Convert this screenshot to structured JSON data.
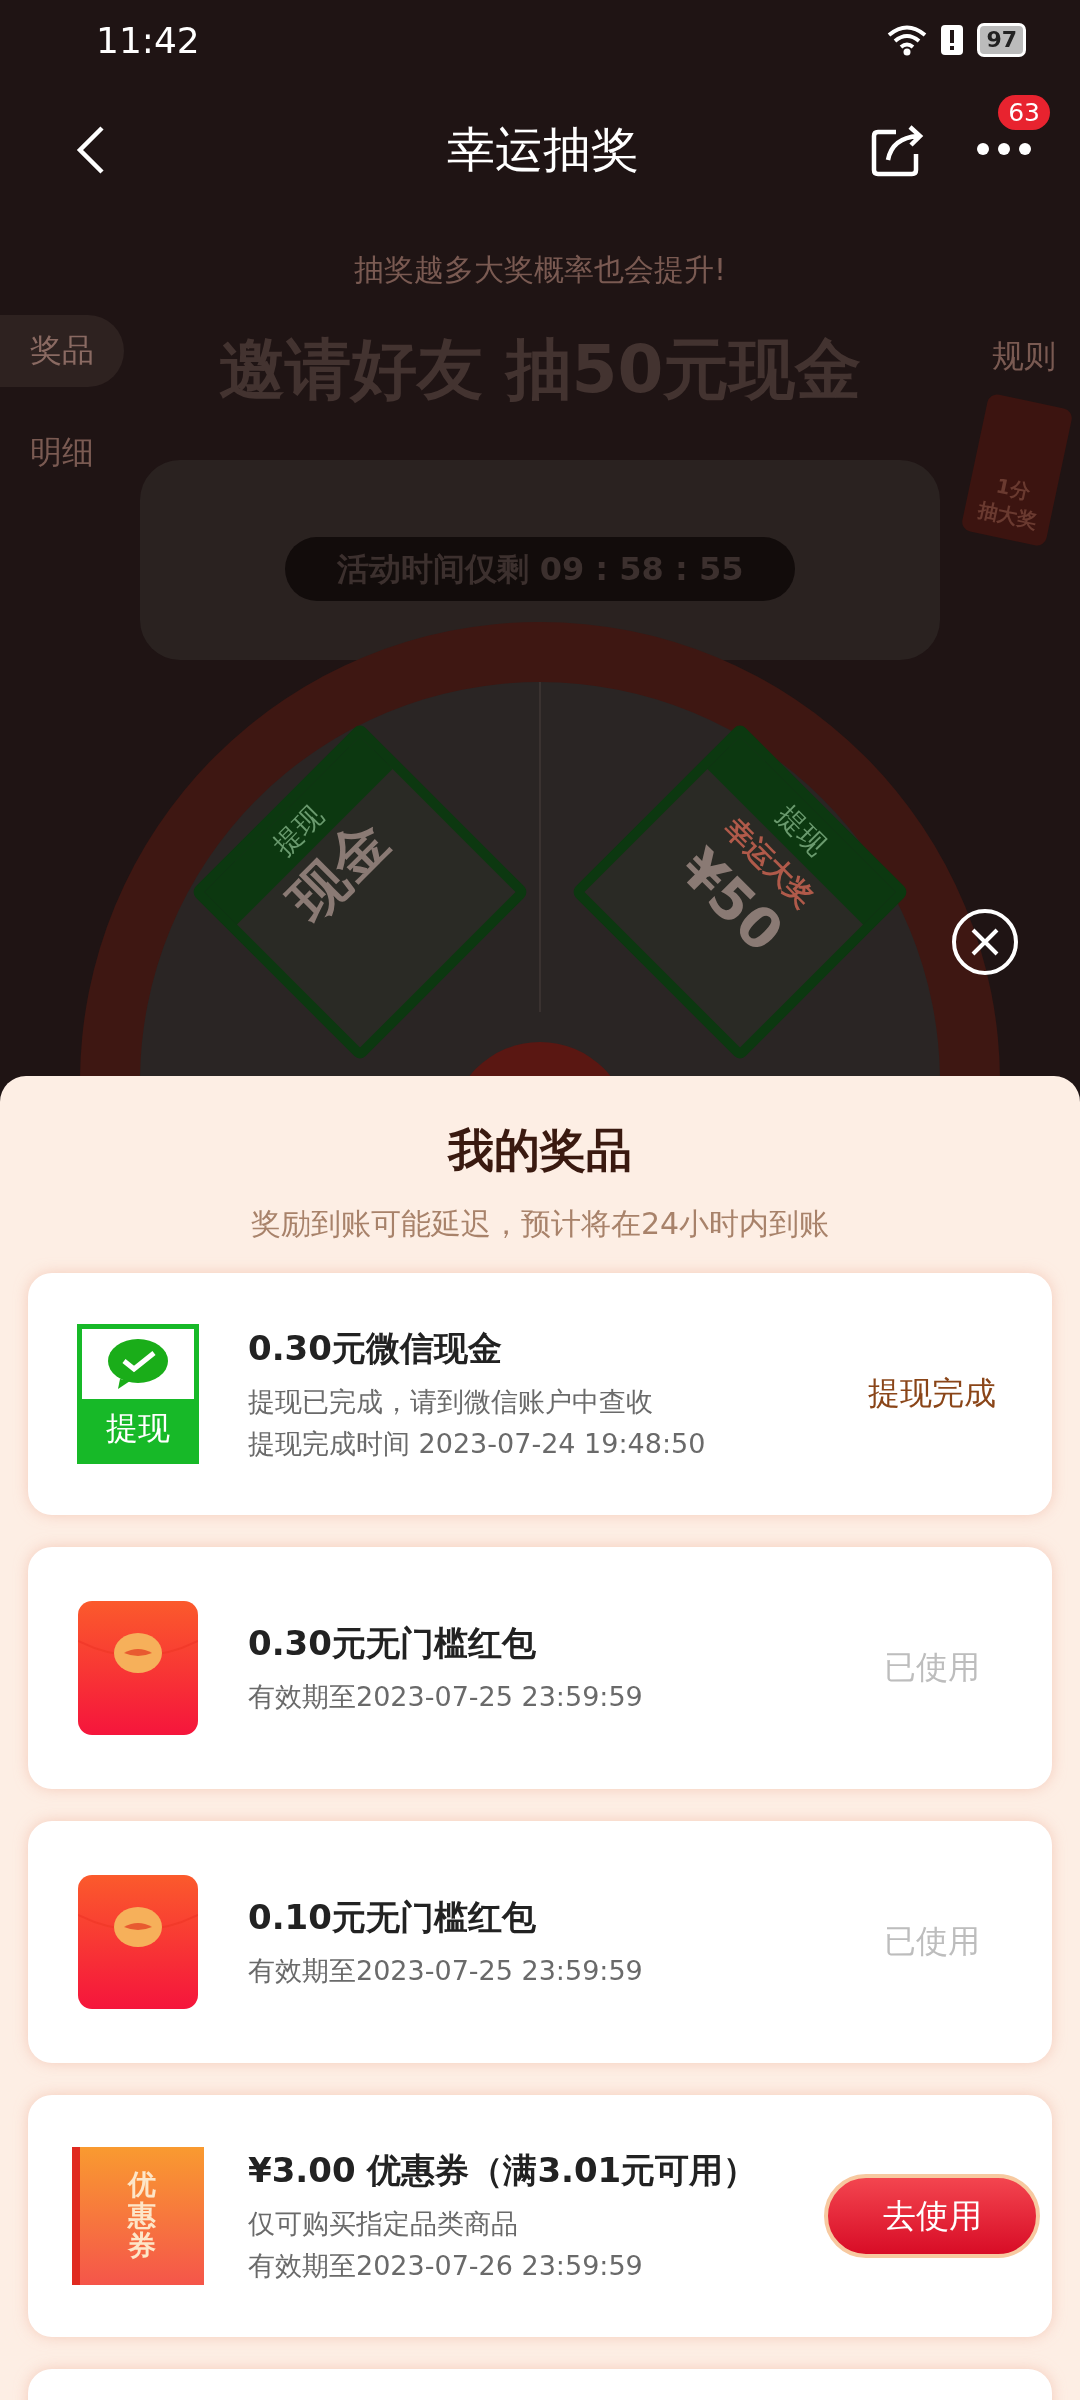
{
  "status_bar": {
    "time": "11:42",
    "battery": "97"
  },
  "nav": {
    "title": "幸运抽奖",
    "badge": "63"
  },
  "backdrop": {
    "hint": "抽奖越多大奖概率也会提升!",
    "banner": "邀请好友 抽50元现金",
    "tabs": [
      {
        "label": "奖品",
        "selected": true
      },
      {
        "label": "明细",
        "selected": false
      }
    ],
    "rules": "规则",
    "promo": [
      "1分",
      "抽大奖"
    ],
    "timer": "活动时间仅剩 09 : 58 : 55",
    "wheel_prizes": [
      {
        "header": "提现",
        "lines": [
          "现金"
        ]
      },
      {
        "header": "提现",
        "lines": [
          "幸运大奖",
          "¥50"
        ]
      }
    ]
  },
  "sheet": {
    "title": "我的奖品",
    "subtitle": "奖励到账可能延迟，预计将在24小时内到账",
    "prizes": [
      {
        "kind": "wechat",
        "icon_label": "提现",
        "title": "0.30元微信现金",
        "details": [
          "提现已完成，请到微信账户中查收",
          "提现完成时间 2023-07-24 19:48:50"
        ],
        "status": {
          "kind": "done",
          "text": "提现完成"
        }
      },
      {
        "kind": "red_packet",
        "title": "0.30元无门槛红包",
        "details": [
          "有效期至2023-07-25 23:59:59"
        ],
        "status": {
          "kind": "used",
          "text": "已使用"
        }
      },
      {
        "kind": "red_packet",
        "title": "0.10元无门槛红包",
        "details": [
          "有效期至2023-07-25 23:59:59"
        ],
        "status": {
          "kind": "used",
          "text": "已使用"
        }
      },
      {
        "kind": "coupon",
        "icon_label": "优惠券",
        "title": "¥3.00 优惠券（满3.01元可用）",
        "details": [
          "仅可购买指定品类商品",
          "有效期至2023-07-26 23:59:59"
        ],
        "status": {
          "kind": "action",
          "text": "去使用"
        }
      }
    ]
  }
}
